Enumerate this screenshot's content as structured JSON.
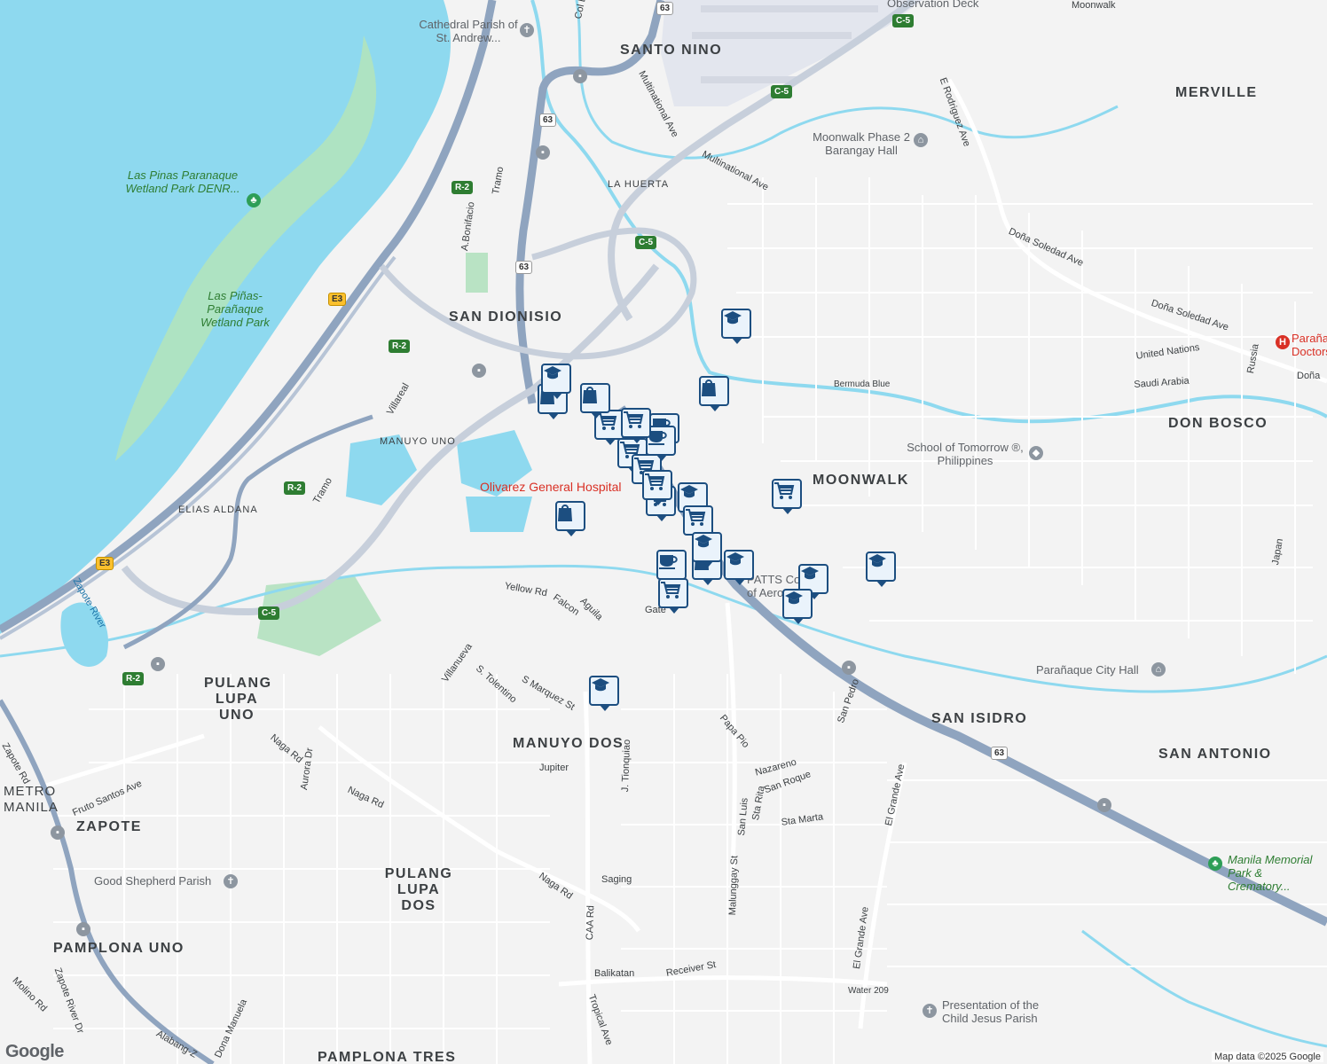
{
  "map": {
    "areas": [
      {
        "id": "santo-nino",
        "text": "SANTO NINO"
      },
      {
        "id": "merville",
        "text": "MERVILLE"
      },
      {
        "id": "san-dionisio",
        "text": "SAN DIONISIO"
      },
      {
        "id": "don-bosco",
        "text": "DON BOSCO"
      },
      {
        "id": "moonwalk",
        "text": "MOONWALK"
      },
      {
        "id": "pulang-lupa-uno",
        "text": "PULANG LUPA UNO"
      },
      {
        "id": "manuyo-dos",
        "text": "MANUYO DOS"
      },
      {
        "id": "san-isidro",
        "text": "SAN ISIDRO"
      },
      {
        "id": "san-antonio",
        "text": "SAN ANTONIO"
      },
      {
        "id": "zapote",
        "text": "ZAPOTE"
      },
      {
        "id": "pulang-lupa-dos",
        "text": "PULANG LUPA DOS"
      },
      {
        "id": "pamplona-uno",
        "text": "PAMPLONA UNO"
      },
      {
        "id": "pamplona-tres",
        "text": "PAMPLONA TRES"
      },
      {
        "id": "metro-manila",
        "text": "METRO MANILA"
      },
      {
        "id": "la-huerta",
        "text": "LA HUERTA"
      },
      {
        "id": "manuyo-uno",
        "text": "MANUYO UNO"
      },
      {
        "id": "elias-aldana",
        "text": "ELIAS ALDANA"
      }
    ],
    "roads": [
      "Col E L De Leon",
      "Multinational Ave",
      "Multinational Ave",
      "E Rodriguez Ave",
      "Doña Soledad Ave",
      "Doña Soledad Ave",
      "A.Bonifacio",
      "Tramo",
      "Villareal",
      "Tramo",
      "Bermuda Blue",
      "United Nations",
      "Saudi Arabia",
      "Russia",
      "Japan",
      "Yellow Rd",
      "Falcon",
      "Aguila",
      "Villanueva",
      "S. Tolentino",
      "S Marquez St",
      "Papa Pio",
      "Naga Rd",
      "Aurora Dr",
      "Naga Rd",
      "Naga Rd",
      "J. Tionquiao",
      "Jupiter",
      "Nazareno",
      "San Roque",
      "Sta Rita",
      "San Luis",
      "Sta Marta",
      "El Grande Ave",
      "El Grande Ave",
      "San Pedro",
      "Fruto Santos Ave",
      "Saging",
      "CAA Rd",
      "Balikatan",
      "Receiver St",
      "Malunggay St",
      "Tropical Ave",
      "Water 209",
      "Molino Rd",
      "Zapote River Dr",
      "Dona Manuela",
      "Alabang-Z",
      "Zapote Rd",
      "Zapote River",
      "Gate",
      "Doña",
      "Moonwalk"
    ],
    "pois": [
      "Cathedral Parish of St. Andrew...",
      "Observation Deck",
      "Moonwalk Phase 2 Barangay Hall",
      "Las Pinas Paranaque Wetland Park DENR...",
      "Las Piñas-Parañaque Wetland Park",
      "School of Tomorrow ®, Philippines",
      "Parañaque City Hall",
      "Manila Memorial Park & Crematory...",
      "Good Shepherd Parish",
      "Presentation of the Child Jesus Parish",
      "PATTS College of Aeron...",
      "Parañaque Doctors..."
    ],
    "hospital": "Olivarez General Hospital",
    "shields": [
      "63",
      "63",
      "63",
      "63",
      "C-5",
      "C-5",
      "C-5",
      "C-5",
      "R-2",
      "R-2",
      "R-2",
      "R-2",
      "E3",
      "E3"
    ],
    "markers": [
      "school",
      "shopping-bag",
      "shopping-bag",
      "shopping-cart",
      "cafe",
      "shopping-cart",
      "school",
      "shopping-bag",
      "cafe",
      "shopping-cart",
      "school",
      "school",
      "school",
      "school",
      "school",
      "shopping-cart",
      "shopping-bag",
      "school",
      "shopping-cart",
      "shopping-cart",
      "shopping-cart",
      "shopping-cart",
      "shopping-bag",
      "cafe",
      "shopping-cart",
      "school"
    ],
    "attribution": "Map data ©2025 Google",
    "logo": "Google"
  }
}
